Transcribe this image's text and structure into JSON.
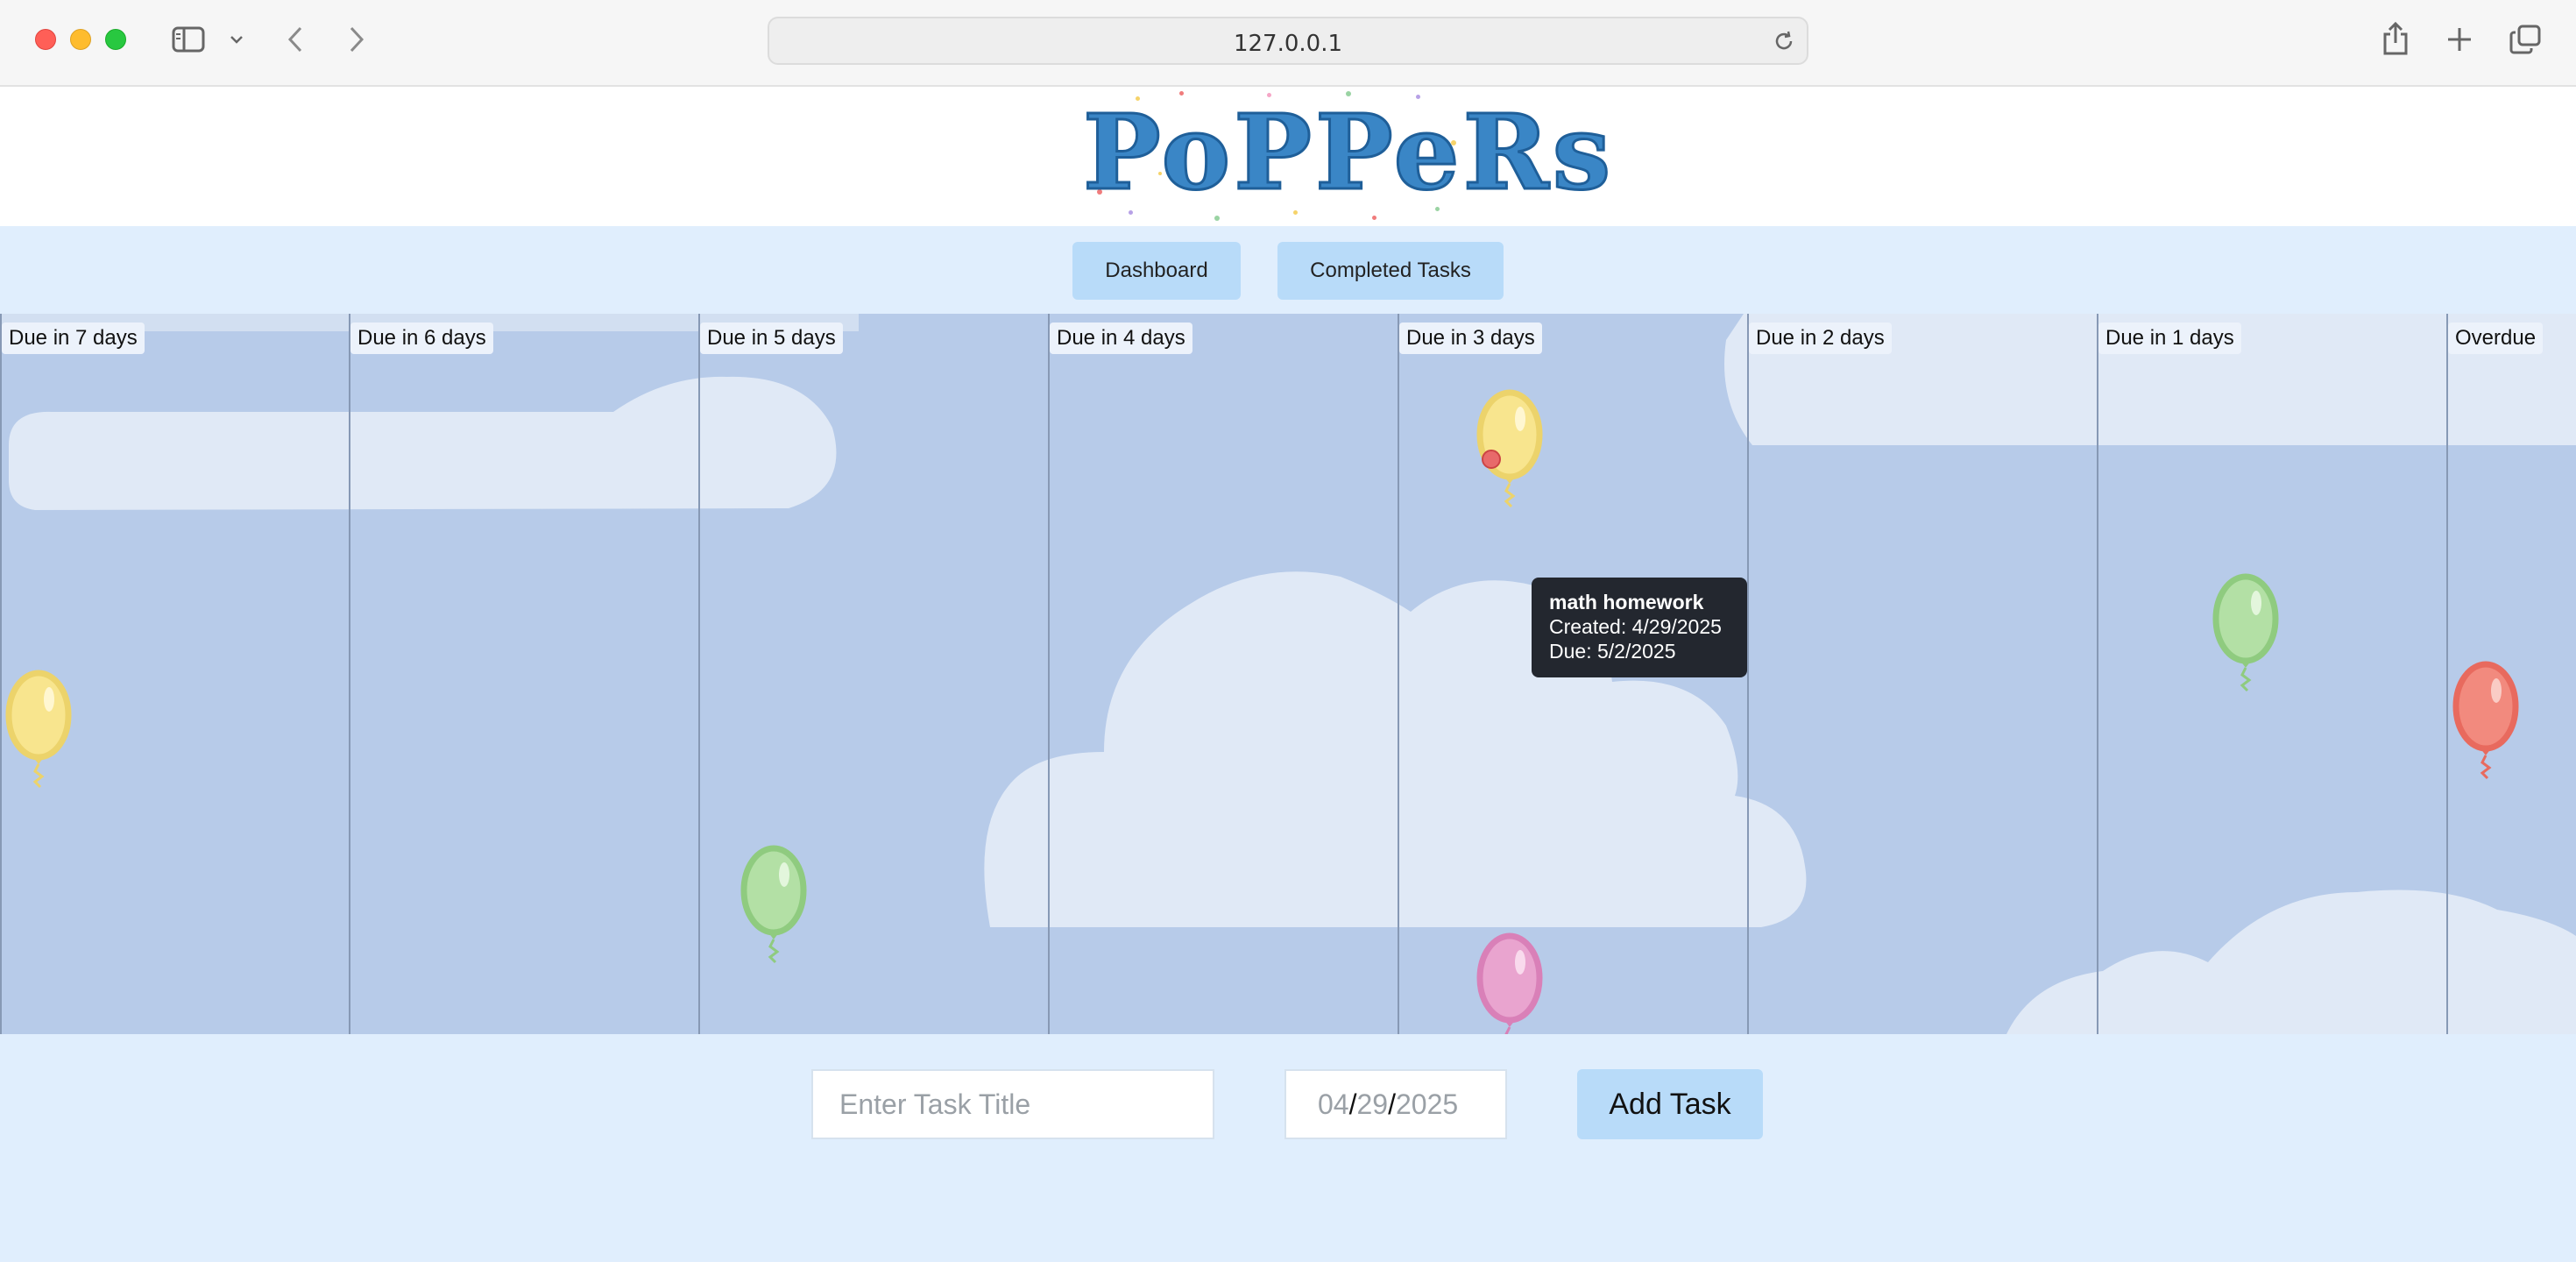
{
  "browser": {
    "url": "127.0.0.1"
  },
  "app": {
    "logo_text": "PoPPeRs"
  },
  "nav": {
    "dashboard_label": "Dashboard",
    "completed_label": "Completed Tasks"
  },
  "columns": [
    {
      "label": "Due in 7 days"
    },
    {
      "label": "Due in 6 days"
    },
    {
      "label": "Due in 5 days"
    },
    {
      "label": "Due in 4 days"
    },
    {
      "label": "Due in 3 days"
    },
    {
      "label": "Due in 2 days"
    },
    {
      "label": "Due in 1 days"
    },
    {
      "label": "Overdue"
    }
  ],
  "balloons": [
    {
      "column": "Due in 7 days",
      "color": "yellow"
    },
    {
      "column": "Due in 5 days",
      "color": "green"
    },
    {
      "column": "Due in 3 days",
      "color": "yellow"
    },
    {
      "column": "Due in 3 days",
      "color": "pink"
    },
    {
      "column": "Due in 1 days",
      "color": "green"
    },
    {
      "column": "Overdue",
      "color": "red"
    }
  ],
  "tooltip": {
    "title": "math homework",
    "created": "Created: 4/29/2025",
    "due": "Due: 5/2/2025"
  },
  "form": {
    "title_placeholder": "Enter Task Title",
    "date_month": "04",
    "date_day": "29",
    "date_year": "2025",
    "add_label": "Add Task"
  },
  "colors": {
    "sky": "#b7cbe9",
    "page_bg": "#e0eefd",
    "button_bg": "#b8dbf9",
    "balloon_yellow": "#f8e58e",
    "balloon_green": "#b3e0a5",
    "balloon_pink": "#e9a4cf",
    "balloon_red": "#f28a7e"
  }
}
